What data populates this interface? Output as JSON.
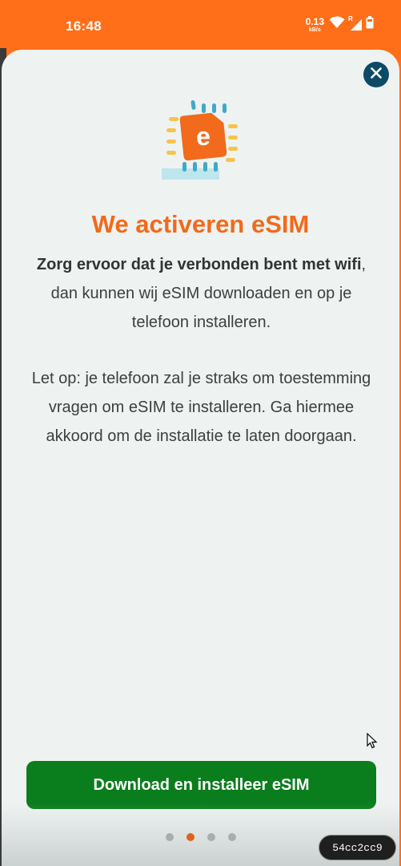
{
  "status_bar": {
    "time": "16:48",
    "net_speed_value": "0.13",
    "net_speed_unit": "kB/s",
    "roaming_label": "R"
  },
  "sheet": {
    "title": "We activeren eSIM",
    "para1_bold": "Zorg ervoor dat je verbonden bent met wifi",
    "para1_rest": ", dan kunnen wij eSIM downloaden en op je telefoon installeren.",
    "para2": "Let op: je telefoon zal je straks om toestemming vragen om eSIM te installeren. Ga hiermee akkoord om de installatie te laten doorgaan.",
    "illustration_letter": "e",
    "cta_label": "Download en installeer eSIM"
  },
  "pager": {
    "count": 4,
    "active_index": 1
  },
  "overlay_tag": "54cc2cc9",
  "colors": {
    "brand_orange": "#ff6f1a",
    "title_orange": "#f26a1b",
    "cta_green": "#0a7d1c",
    "close_navy": "#0d4a66",
    "sheet_bg": "#eef3f2"
  },
  "icons": {
    "close": "close-icon",
    "wifi": "wifi-icon",
    "signal": "signal-icon",
    "battery": "battery-icon",
    "sim": "esim-chip-icon",
    "cursor": "mouse-cursor-icon"
  }
}
